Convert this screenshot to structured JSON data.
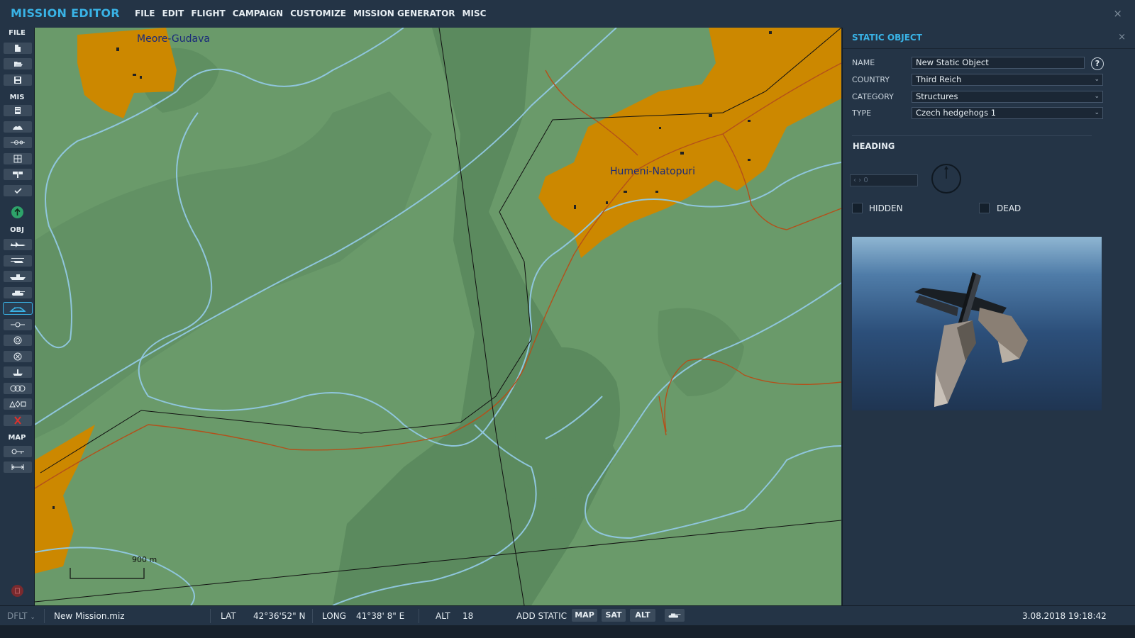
{
  "app": {
    "title": "MISSION EDITOR",
    "menu": [
      "FILE",
      "EDIT",
      "FLIGHT",
      "CAMPAIGN",
      "CUSTOMIZE",
      "MISSION GENERATOR",
      "MISC"
    ],
    "close_glyph": "×"
  },
  "toolbar": {
    "sections": {
      "file": "FILE",
      "mis": "MIS",
      "obj": "OBJ",
      "map": "MAP"
    },
    "buttons": [
      "new-file-icon",
      "open-file-icon",
      "save-file-icon",
      "briefing-icon",
      "weather-icon",
      "triggers-icon",
      "trigger-zone-icon",
      "goals-icon",
      "check-icon",
      "upload-icon",
      "airplane-icon",
      "helicopter-icon",
      "ship-icon",
      "ground-vehicle-icon",
      "static-object-icon",
      "waypoint-icon",
      "target-icon",
      "remove-icon",
      "nav-point-icon",
      "template-icon",
      "shapes-icon",
      "delete-icon",
      "map-options-icon",
      "ruler-icon",
      "eraser-icon"
    ]
  },
  "map": {
    "towns": [
      "Meore-Gudava",
      "Humeni-Natopuri"
    ],
    "scale": "900 m",
    "colors": {
      "terrain": "#6a9a6a",
      "forest": "#5b8a5e",
      "town": "#cc8800",
      "river": "#8fc6dc",
      "road": "#b4501a",
      "boundary": "#111111"
    }
  },
  "panel": {
    "title": "STATIC OBJECT",
    "close_glyph": "×",
    "help": "?",
    "fields": [
      {
        "label": "NAME",
        "value": "New Static Object"
      },
      {
        "label": "COUNTRY",
        "value": "Third Reich"
      },
      {
        "label": "CATEGORY",
        "value": "Structures"
      },
      {
        "label": "TYPE",
        "value": "Czech hedgehogs 1"
      }
    ],
    "heading_title": "HEADING",
    "heading_value": "0",
    "hidden_label": "HIDDEN",
    "dead_label": "DEAD",
    "hidden_checked": false,
    "dead_checked": false
  },
  "status": {
    "profile": "DFLT",
    "file": "New Mission.miz",
    "lat_label": "LAT",
    "lat": "42°36'52\" N",
    "long_label": "LONG",
    "long": "41°38' 8\" E",
    "alt_label": "ALT",
    "alt": "18",
    "mode": "ADD STATIC",
    "map_btn": "MAP",
    "sat_btn": "SAT",
    "alt_btn": "ALT",
    "datetime": "3.08.2018 19:18:42"
  }
}
